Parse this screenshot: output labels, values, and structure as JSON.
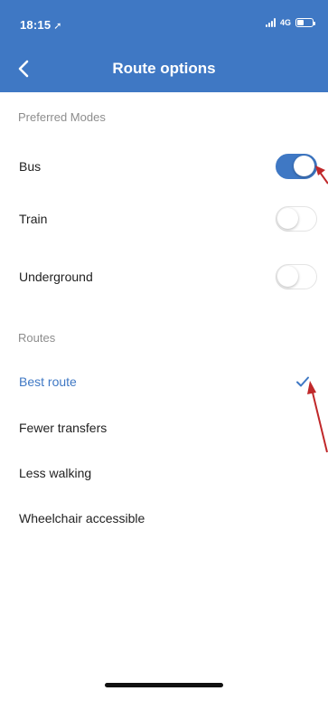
{
  "status_bar": {
    "time": "18:15",
    "network": "4G",
    "icons": [
      "location-arrow-icon",
      "signal-icon",
      "battery-icon"
    ]
  },
  "nav": {
    "back_icon": "chevron-left-icon",
    "title": "Route options"
  },
  "sections": {
    "modes": {
      "header": "Preferred Modes",
      "items": [
        {
          "label": "Bus",
          "enabled": true
        },
        {
          "label": "Train",
          "enabled": false
        },
        {
          "label": "Underground",
          "enabled": false
        }
      ]
    },
    "routes": {
      "header": "Routes",
      "items": [
        {
          "label": "Best route",
          "selected": true
        },
        {
          "label": "Fewer transfers",
          "selected": false
        },
        {
          "label": "Less walking",
          "selected": false
        },
        {
          "label": "Wheelchair accessible",
          "selected": false
        }
      ]
    }
  },
  "colors": {
    "accent": "#3f78c4",
    "annotation_arrow": "#c0282a"
  }
}
